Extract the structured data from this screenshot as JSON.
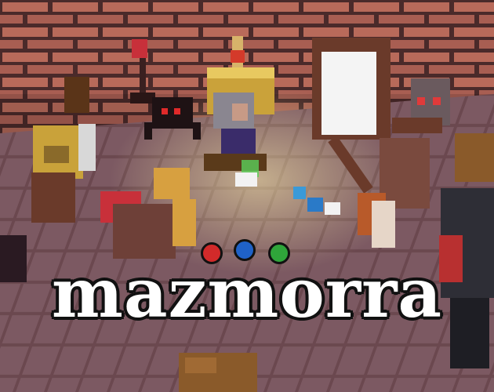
{
  "game": {
    "title": "mazmorra",
    "dots": [
      {
        "name": "red",
        "color": "#d22a2a"
      },
      {
        "name": "blue",
        "color": "#1f62c8"
      },
      {
        "name": "green",
        "color": "#2fa53a"
      }
    ]
  },
  "palette": {
    "brick": "#b86a5a",
    "mortar": "#4a2a2a",
    "floor": "#8a5f66",
    "floor_dark": "#6e4850",
    "door_light": "#f4f4f4"
  }
}
